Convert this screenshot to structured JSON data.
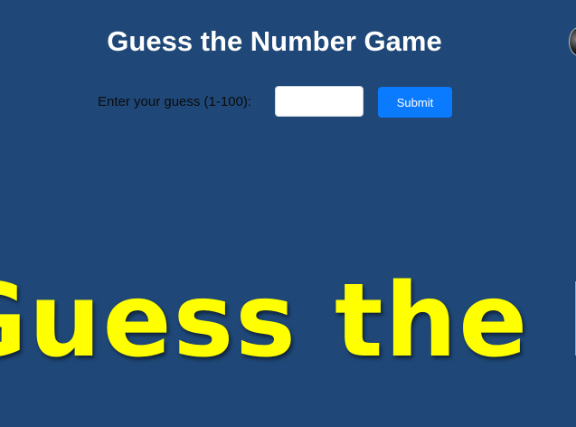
{
  "game": {
    "title": "Guess the Number Game",
    "prompt_label": "Enter your guess (1-100):",
    "guess_value": "",
    "guess_placeholder": "",
    "submit_label": "Submit",
    "banner_text": "Guess the Number"
  },
  "colors": {
    "background": "#1f4878",
    "title": "#ffffff",
    "submit_button": "#0a7bff",
    "banner": "#ffff00"
  },
  "icons": {
    "corner": "ball-icon"
  }
}
